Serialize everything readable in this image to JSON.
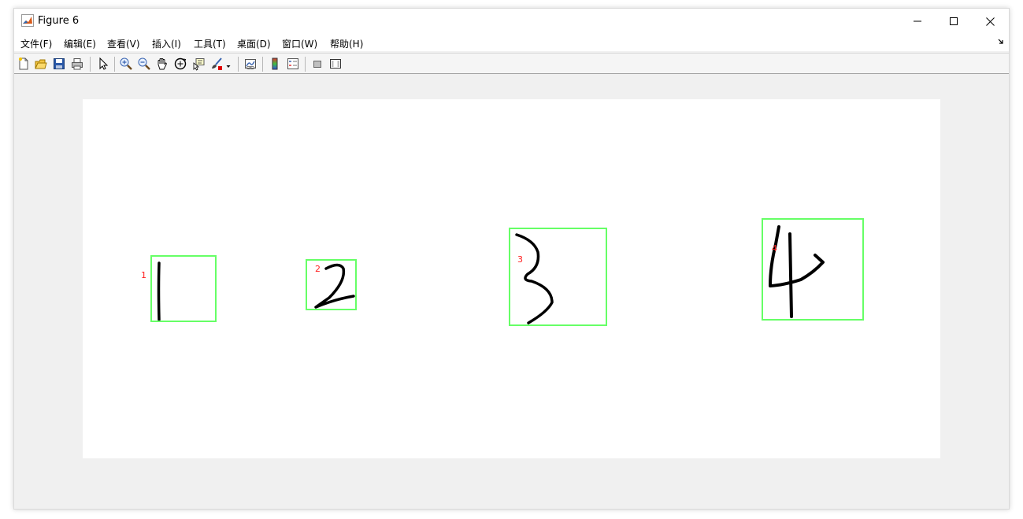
{
  "window": {
    "title": "Figure 6",
    "controls": {
      "minimize": "minimize",
      "maximize": "maximize",
      "close": "close"
    }
  },
  "menubar": {
    "items": [
      {
        "label": "文件(F)"
      },
      {
        "label": "编辑(E)"
      },
      {
        "label": "查看(V)"
      },
      {
        "label": "插入(I)"
      },
      {
        "label": "工具(T)"
      },
      {
        "label": "桌面(D)"
      },
      {
        "label": "窗口(W)"
      },
      {
        "label": "帮助(H)"
      }
    ]
  },
  "toolbar": {
    "tools": [
      "new-figure-icon",
      "open-file-icon",
      "save-icon",
      "print-icon",
      "select-arrow-icon",
      "zoom-in-icon",
      "zoom-out-icon",
      "pan-hand-icon",
      "rotate-3d-icon",
      "data-cursor-icon",
      "brush-icon",
      "link-plot-icon",
      "colorbar-icon",
      "legend-icon",
      "hide-plot-tools-icon",
      "show-plot-tools-icon"
    ]
  },
  "figure": {
    "background": "#ffffff",
    "box_color": "#66ff66",
    "label_color": "#ff2020",
    "stroke_color": "#000000",
    "regions": [
      {
        "label": "1"
      },
      {
        "label": "2"
      },
      {
        "label": "3"
      },
      {
        "label": "4"
      }
    ]
  }
}
